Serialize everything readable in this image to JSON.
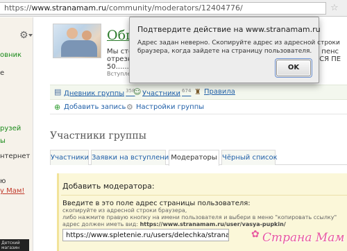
{
  "browser": {
    "url_scheme": "https://",
    "url_host": "www.stranamam.ru",
    "url_path": "/community/moderators/12404776/"
  },
  "sidebar": {
    "link1": "овник",
    "text1": "е",
    "link2": "рузей",
    "link3": "ы",
    "text2": "нтернет",
    "text3": "ю",
    "red1": "у Мам!",
    "thumb_caption": "Детский магазин"
  },
  "group": {
    "title": "Общ",
    "desc_line1": "Мы стол",
    "desc_line2": "отрезка",
    "desc_line3": "50.......!",
    "joined": "Вступлен",
    "right_line1": "а пенс",
    "right_line2": "ТСЯ ПЕ"
  },
  "links": {
    "diary": "Дневник группы",
    "diary_count": "358",
    "members": "Участники",
    "members_count": "674",
    "rules": "Правила",
    "add_post": "Добавить запись",
    "settings": "Настройки группы"
  },
  "section": {
    "title": "Участники группы"
  },
  "tabs": [
    {
      "label": "Участники"
    },
    {
      "label": "Заявки на вступление"
    },
    {
      "label": "Модераторы"
    },
    {
      "label": "Чёрный список"
    }
  ],
  "panel": {
    "title": "Добавить модератора:",
    "label": "Введите в это поле адрес страницы пользователя:",
    "help1": "скопируйте из адресной строки браузера,",
    "help2": "либо нажмите правую кнопку на имени пользователя и выбери в меню \"копировать ссылку\"",
    "help3_prefix": "адрес должен иметь вид: ",
    "help3_example": "https://www.stranamam.ru/user/vasya-pupkin/",
    "input_value": "https://www.spletenie.ru/users/delechka/stranamam/"
  },
  "watermark": "Страна Мам",
  "dialog": {
    "title": "Подтвердите действие на www.stranamam.ru",
    "msg_line1": "Адрес задан неверно. Скопируйте адрес из адресной строки",
    "msg_line2": "браузера, когда зайдете на страницу пользователя.",
    "ok_label": "OK"
  },
  "colors": {
    "link_green": "#2a7a2a",
    "link_blue": "#1f5fa8",
    "panel_bg": "#fbf7d9",
    "watermark": "#e85aa0"
  }
}
